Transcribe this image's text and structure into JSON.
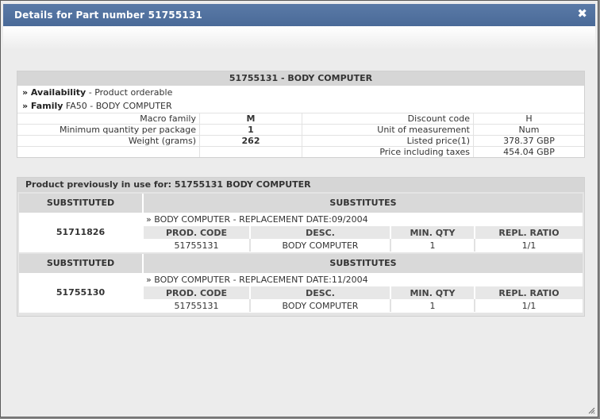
{
  "dialog": {
    "title": "Details for Part number 51755131",
    "close_glyph": "✖"
  },
  "detail": {
    "header": "51755131 - BODY COMPUTER",
    "availability_label": "» Availability",
    "availability_value": " - Product orderable",
    "family_label": "» Family",
    "family_value": " FA50 - BODY COMPUTER",
    "rows": [
      {
        "label1": "Macro family",
        "value1": "M",
        "label2": "Discount code",
        "value2": "H"
      },
      {
        "label1": "Minimum quantity per package",
        "value1": "1",
        "label2": "Unit of measurement",
        "value2": "Num"
      },
      {
        "label1": "Weight (grams)",
        "value1": "262",
        "label2": "Listed price(1)",
        "value2": "378.37 GBP"
      },
      {
        "label1": "",
        "value1": "",
        "label2": "Price including taxes",
        "value2": "454.04 GBP"
      }
    ]
  },
  "subs": {
    "header": "Product previously in use for: 51755131 BODY COMPUTER",
    "col_substituted": "SUBSTITUTED",
    "col_substitutes": "SUBSTITUTES",
    "sub_headers": {
      "code": "PROD. CODE",
      "desc": "DESC.",
      "min_qty": "MIN. QTY",
      "ratio": "REPL. RATIO"
    },
    "blocks": [
      {
        "part_number": "51711826",
        "replacement": "» BODY COMPUTER - REPLACEMENT DATE:09/2004",
        "code": "51755131",
        "desc": "BODY COMPUTER",
        "min_qty": "1",
        "ratio": "1/1"
      },
      {
        "part_number": "51755130",
        "replacement": "» BODY COMPUTER - REPLACEMENT DATE:11/2004",
        "code": "51755131",
        "desc": "BODY COMPUTER",
        "min_qty": "1",
        "ratio": "1/1"
      }
    ]
  }
}
